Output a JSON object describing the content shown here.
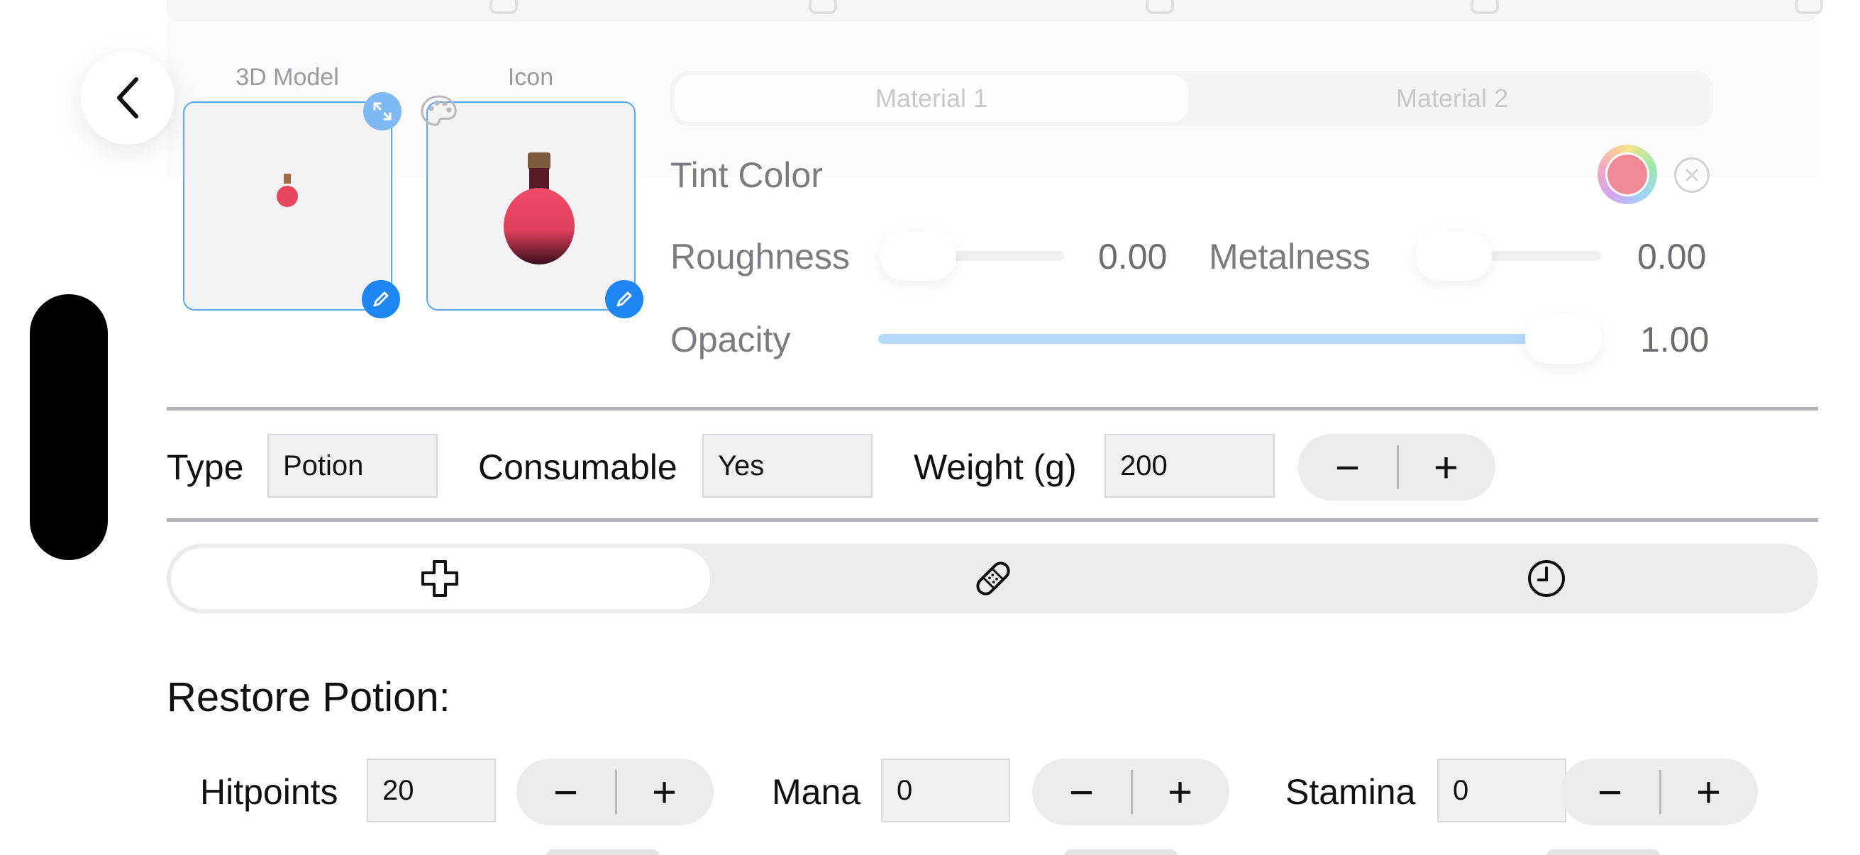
{
  "assets": {
    "model_label": "3D Model",
    "icon_label": "Icon"
  },
  "material": {
    "tabs": [
      "Material 1",
      "Material 2"
    ],
    "tint_label": "Tint Color",
    "tint_color": "#f08a97",
    "roughness_label": "Roughness",
    "roughness_value": "0.00",
    "metalness_label": "Metalness",
    "metalness_value": "0.00",
    "opacity_label": "Opacity",
    "opacity_value": "1.00",
    "opacity_fraction": 1.0
  },
  "properties": {
    "type_label": "Type",
    "type_value": "Potion",
    "consumable_label": "Consumable",
    "consumable_value": "Yes",
    "weight_label": "Weight (g)",
    "weight_value": "200"
  },
  "effect_tabs": [
    {
      "icon": "plus-outline-icon",
      "selected": true
    },
    {
      "icon": "bandage-icon",
      "selected": false
    },
    {
      "icon": "clock-icon",
      "selected": false
    }
  ],
  "restore": {
    "title": "Restore Potion:",
    "hitpoints_label": "Hitpoints",
    "hitpoints_value": "20",
    "mana_label": "Mana",
    "mana_value": "0",
    "stamina_label": "Stamina",
    "stamina_value": "0"
  },
  "stepper": {
    "minus": "−",
    "plus": "+"
  },
  "colors": {
    "accent": "#1d86f0",
    "slider_fill": "#b5dafa"
  }
}
